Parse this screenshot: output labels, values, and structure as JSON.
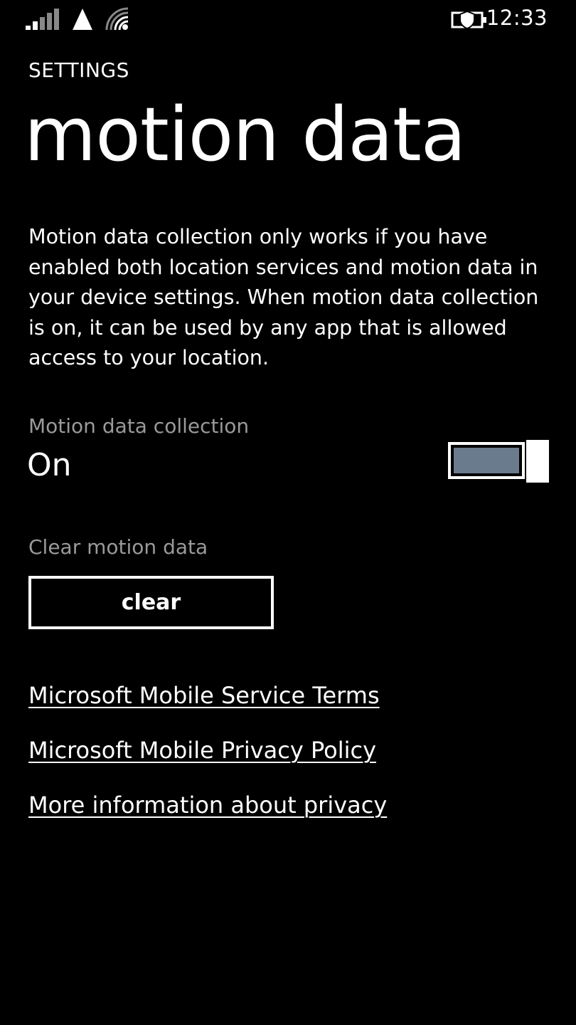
{
  "status_bar": {
    "time": "12:33",
    "icons": [
      "signal-strength-icon",
      "data-connection-icon",
      "wifi-icon",
      "battery-saver-icon"
    ]
  },
  "header": {
    "app_title": "SETTINGS",
    "page_title": "motion data"
  },
  "description": "Motion data collection only works if you have enabled both location services and motion data in your device settings. When motion data collection is on, it can be used by any app that is allowed access to your location.",
  "motion_collection": {
    "label": "Motion data collection",
    "state": "On",
    "enabled": true
  },
  "clear_section": {
    "label": "Clear motion data",
    "button_label": "clear"
  },
  "links": [
    "Microsoft Mobile Service Terms",
    "Microsoft Mobile Privacy Policy",
    "More information about privacy"
  ],
  "colors": {
    "background": "#000000",
    "foreground": "#ffffff",
    "secondary_text": "#9a9a9a",
    "toggle_fill": "#6b7b8e"
  }
}
